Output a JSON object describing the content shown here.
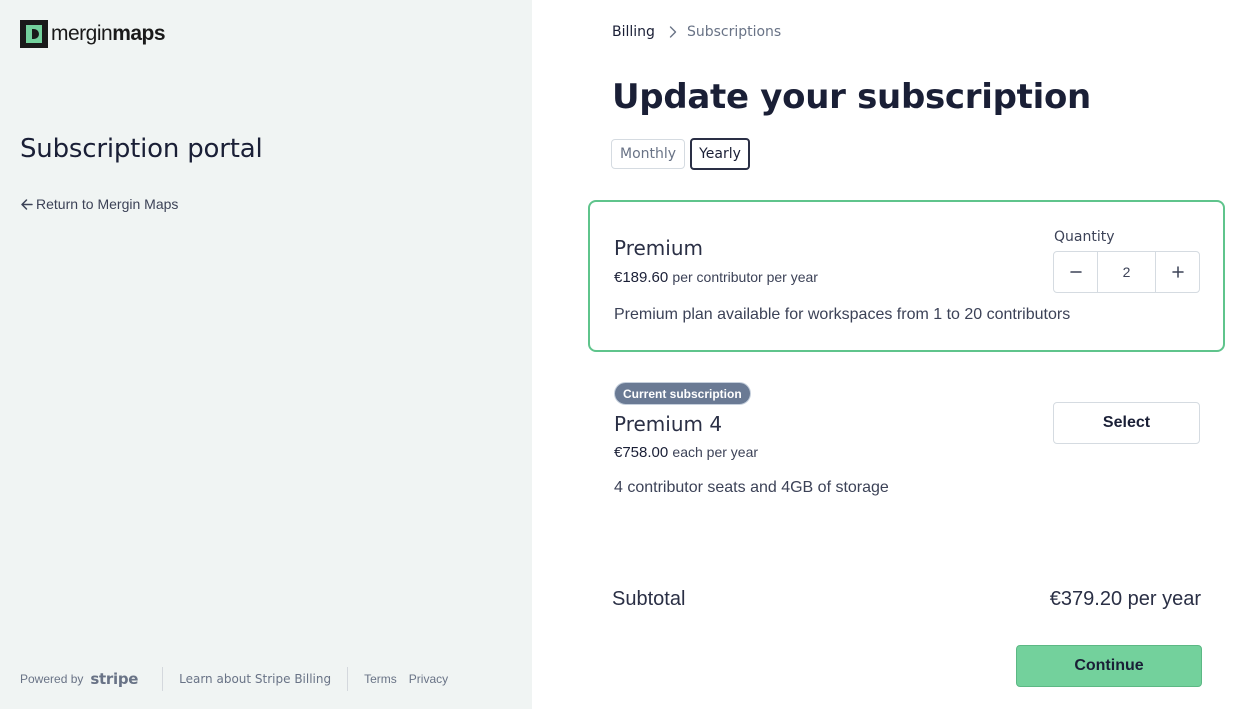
{
  "brand": {
    "logo_text_regular": "mergin",
    "logo_text_bold": "maps",
    "accent_green": "#73d19c"
  },
  "sidebar": {
    "title": "Subscription portal",
    "return_link": "Return to Mergin Maps",
    "return_icon": "arrow-left-icon"
  },
  "footer": {
    "powered_by": "Powered by",
    "stripe": "stripe",
    "learn": "Learn about Stripe Billing",
    "terms": "Terms",
    "privacy": "Privacy"
  },
  "breadcrumb": {
    "items": [
      "Billing",
      "Subscriptions"
    ],
    "separator_icon": "chevron-right-icon"
  },
  "main": {
    "title": "Update your subscription",
    "tabs": [
      {
        "label": "Monthly",
        "active": false
      },
      {
        "label": "Yearly",
        "active": true
      }
    ]
  },
  "plan": {
    "name": "Premium",
    "price": "€189.60",
    "price_unit": "per contributor per year",
    "description": "Premium plan available for workspaces from 1 to 20 contributors",
    "quantity_label": "Quantity",
    "quantity": "2",
    "decrement_icon": "minus-icon",
    "increment_icon": "plus-icon",
    "border_color": "#5fc48c"
  },
  "current": {
    "badge": "Current subscription",
    "name": "Premium 4",
    "price": "€758.00",
    "price_unit": "each per year",
    "description": "4 contributor seats and 4GB of storage",
    "select_label": "Select"
  },
  "summary": {
    "subtotal_label": "Subtotal",
    "subtotal_value": "€379.20 per year",
    "continue_label": "Continue"
  }
}
